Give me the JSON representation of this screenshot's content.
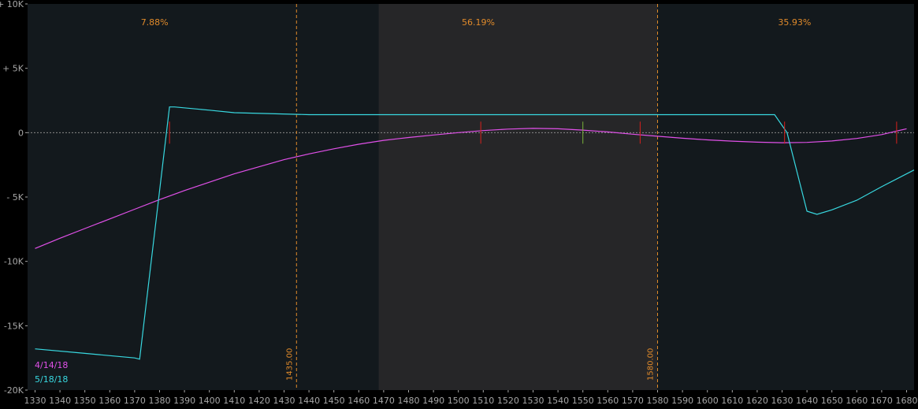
{
  "chart_data": {
    "type": "line",
    "xlabel": "",
    "ylabel": "",
    "xlim": [
      1327,
      1683
    ],
    "ylim": [
      -20000,
      10000
    ],
    "x_ticks": [
      1330,
      1340,
      1350,
      1360,
      1370,
      1380,
      1390,
      1400,
      1410,
      1420,
      1430,
      1440,
      1450,
      1460,
      1470,
      1480,
      1490,
      1500,
      1510,
      1520,
      1530,
      1540,
      1550,
      1560,
      1570,
      1580,
      1590,
      1600,
      1610,
      1620,
      1630,
      1640,
      1650,
      1660,
      1670,
      1680
    ],
    "y_ticks": [
      {
        "value": 10000,
        "label": "+ 10K"
      },
      {
        "value": 5000,
        "label": "+ 5K"
      },
      {
        "value": 0,
        "label": "0"
      },
      {
        "value": -5000,
        "label": "- 5K"
      },
      {
        "value": -10000,
        "label": "-10K"
      },
      {
        "value": -15000,
        "label": "-15K"
      },
      {
        "value": -20000,
        "label": "-20K"
      }
    ],
    "grid": false,
    "zero_line": true,
    "shaded_region": {
      "x": [
        1468,
        1580
      ]
    },
    "vertical_lines": [
      {
        "x": 1435,
        "label": "1435.00"
      },
      {
        "x": 1580,
        "label": "1580.00"
      }
    ],
    "probabilities": [
      "7.88%",
      "56.19%",
      "35.93%"
    ],
    "legend_position": "bottom-left",
    "series": [
      {
        "name": "4/14/18",
        "color": "#e050e8",
        "x": [
          1330,
          1340,
          1350,
          1360,
          1370,
          1380,
          1390,
          1400,
          1410,
          1420,
          1430,
          1440,
          1450,
          1460,
          1470,
          1480,
          1490,
          1500,
          1510,
          1520,
          1530,
          1540,
          1550,
          1560,
          1570,
          1580,
          1590,
          1600,
          1610,
          1620,
          1630,
          1640,
          1650,
          1660,
          1670,
          1680
        ],
        "y": [
          -9000,
          -8200,
          -7450,
          -6700,
          -5950,
          -5200,
          -4500,
          -3850,
          -3200,
          -2650,
          -2100,
          -1650,
          -1250,
          -900,
          -600,
          -380,
          -180,
          0,
          160,
          280,
          330,
          300,
          200,
          60,
          -120,
          -280,
          -430,
          -560,
          -660,
          -740,
          -780,
          -760,
          -650,
          -450,
          -150,
          300
        ]
      },
      {
        "name": "5/18/18",
        "color": "#38d8e0",
        "x": [
          1330,
          1350,
          1370,
          1372,
          1384,
          1386,
          1400,
          1410,
          1440,
          1500,
          1560,
          1600,
          1627,
          1632,
          1640,
          1644,
          1650,
          1660,
          1670,
          1683
        ],
        "y": [
          -16800,
          -17150,
          -17500,
          -17600,
          2000,
          2000,
          1750,
          1550,
          1400,
          1400,
          1400,
          1400,
          1400,
          0,
          -6100,
          -6350,
          -6000,
          -5250,
          -4200,
          -2900
        ]
      }
    ],
    "markers": [
      {
        "x": 1384,
        "color": "#d8201c"
      },
      {
        "x": 1509,
        "color": "#d8201c"
      },
      {
        "x": 1550,
        "color": "#7ab33a"
      },
      {
        "x": 1573,
        "color": "#d8201c"
      },
      {
        "x": 1631,
        "color": "#d8201c"
      },
      {
        "x": 1676,
        "color": "#d8201c"
      }
    ],
    "colors": {
      "background": "#000000",
      "plot_background": "#13191d",
      "shaded_background": "#262628",
      "axis_text": "#a6a6a6",
      "annotation": "#e08a2a",
      "zero_line": "#8a8a8a"
    }
  }
}
